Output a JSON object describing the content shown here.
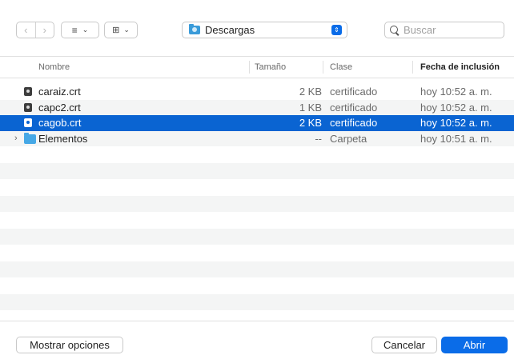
{
  "toolbar": {
    "back_icon": "chevron-left-icon",
    "forward_icon": "chevron-right-icon",
    "list_view_icon": "≡",
    "group_view_icon": "⊞",
    "dropdown_caret": "⌄",
    "location": "Descargas",
    "location_stepper": "⇕",
    "search_placeholder": "Buscar",
    "search_value": ""
  },
  "columns": {
    "name": "Nombre",
    "size": "Tamaño",
    "kind": "Clase",
    "date": "Fecha de inclusión"
  },
  "files": [
    {
      "name": "caraiz.crt",
      "size": "2 KB",
      "kind": "certificado",
      "date": "hoy 10:52 a. m.",
      "type": "file",
      "selected": false
    },
    {
      "name": "capc2.crt",
      "size": "1 KB",
      "kind": "certificado",
      "date": "hoy 10:52 a. m.",
      "type": "file",
      "selected": false
    },
    {
      "name": "cagob.crt",
      "size": "2 KB",
      "kind": "certificado",
      "date": "hoy 10:52 a. m.",
      "type": "file",
      "selected": true
    },
    {
      "name": "Elementos",
      "size": "--",
      "kind": "Carpeta",
      "date": "hoy 10:51 a. m.",
      "type": "folder",
      "selected": false
    }
  ],
  "footer": {
    "options_label": "Mostrar opciones",
    "cancel_label": "Cancelar",
    "open_label": "Abrir"
  },
  "colors": {
    "accent": "#0a6ce8",
    "selection": "#0a64d2",
    "stripe": "#f4f5f5"
  }
}
